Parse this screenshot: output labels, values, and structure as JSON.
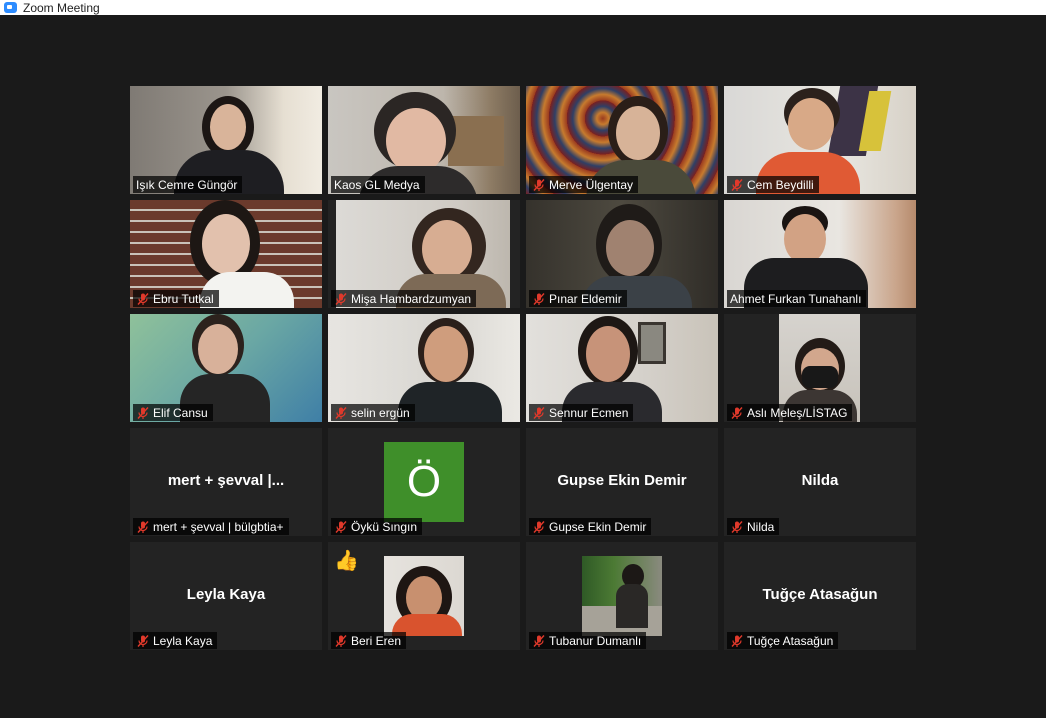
{
  "window": {
    "title": "Zoom Meeting"
  },
  "participants": [
    {
      "name": "Işık Cemre Güngör",
      "muted": false,
      "type": "video"
    },
    {
      "name": "Kaos GL Medya",
      "muted": false,
      "type": "video",
      "active_speaker": true
    },
    {
      "name": "Merve Ülgentay",
      "muted": true,
      "type": "video"
    },
    {
      "name": "Cem Beydilli",
      "muted": true,
      "type": "video"
    },
    {
      "name": "Ebru Tutkal",
      "muted": true,
      "type": "video"
    },
    {
      "name": "Mişa Hambardzumyan",
      "muted": true,
      "type": "video"
    },
    {
      "name": "Pınar Eldemir",
      "muted": true,
      "type": "video"
    },
    {
      "name": "Ahmet Furkan Tunahanlı",
      "muted": false,
      "type": "video"
    },
    {
      "name": "Elif Cansu",
      "muted": true,
      "type": "video"
    },
    {
      "name": "selin ergün",
      "muted": true,
      "type": "video"
    },
    {
      "name": "Sennur Ecmen",
      "muted": true,
      "type": "video"
    },
    {
      "name": "Aslı Meleş/LİSTAG",
      "muted": true,
      "type": "video"
    },
    {
      "name": "mert + şevval | bülgbtia+",
      "display_name": "mert + şevval |...",
      "muted": true,
      "type": "name"
    },
    {
      "name": "Öykü Sıngın",
      "letter": "Ö",
      "muted": true,
      "type": "letter"
    },
    {
      "name": "Gupse Ekin Demir",
      "display_name": "Gupse Ekin Demir",
      "muted": true,
      "type": "name"
    },
    {
      "name": "Nilda",
      "display_name": "Nilda",
      "muted": true,
      "type": "name"
    },
    {
      "name": "Leyla Kaya",
      "display_name": "Leyla Kaya",
      "muted": true,
      "type": "name"
    },
    {
      "name": "Beri Eren",
      "muted": true,
      "type": "photo",
      "reaction": "👍"
    },
    {
      "name": "Tubanur Dumanlı",
      "muted": true,
      "type": "photo"
    },
    {
      "name": "Tuğçe Atasağun",
      "display_name": "Tuğçe Atasağun",
      "muted": true,
      "type": "name"
    }
  ],
  "colors": {
    "active_border": "#b8de5a",
    "mute": "#e0392b",
    "tile_bg": "#232323",
    "letter_bg": "#3f8f2a"
  }
}
